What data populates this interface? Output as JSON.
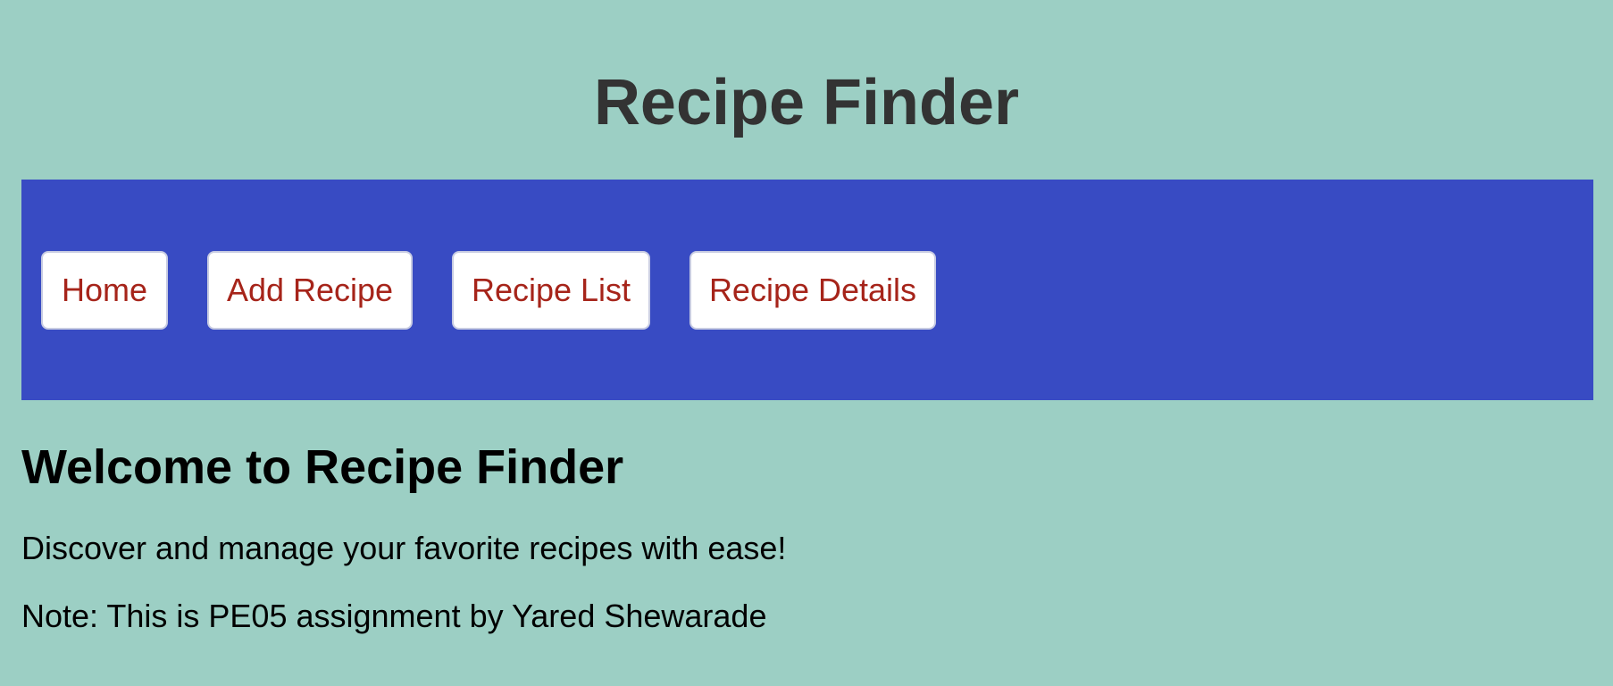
{
  "header": {
    "title": "Recipe Finder"
  },
  "nav": {
    "items": [
      {
        "label": "Home"
      },
      {
        "label": "Add Recipe"
      },
      {
        "label": "Recipe List"
      },
      {
        "label": "Recipe Details"
      }
    ]
  },
  "main": {
    "heading": "Welcome to Recipe Finder",
    "tagline": "Discover and manage your favorite recipes with ease!",
    "note": "Note: This is PE05 assignment by Yared Shewarade"
  },
  "colors": {
    "background": "#9ccfc4",
    "nav_background": "#384bc3",
    "button_background": "#ffffff",
    "button_text": "#a6241a",
    "title_text": "#333333"
  }
}
